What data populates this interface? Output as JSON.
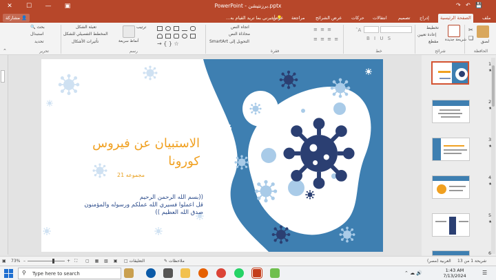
{
  "window": {
    "title": "PowerPoint - برزنتيشن.pptx",
    "signin_prompt": "أخبرني بما تريد القيام به...",
    "share_label": "مشاركة"
  },
  "tabs": [
    {
      "label": "ملف"
    },
    {
      "label": "الصفحة الرئيسية",
      "active": true
    },
    {
      "label": "إدراج"
    },
    {
      "label": "تصميم"
    },
    {
      "label": "انتقالات"
    },
    {
      "label": "حركات"
    },
    {
      "label": "عرض الشرائح"
    },
    {
      "label": "مراجعة"
    },
    {
      "label": "عرض"
    }
  ],
  "ribbon": {
    "clipboard": {
      "paste": "لصق",
      "group": "الحافظة"
    },
    "slides": {
      "new_slide": "شريحة جديدة",
      "layout": "تخطيط",
      "reset": "إعادة تعيين",
      "section": "مقطع",
      "group": "شرائح"
    },
    "font": {
      "group": "خط"
    },
    "paragraph": {
      "text_direction": "اتجاه النص",
      "align_text": "محاذاة النص",
      "smartart": "التحويل إلى SmartArt",
      "group": "فقرة"
    },
    "drawing": {
      "arrange": "ترتيب",
      "quick_styles": "أنماط سريعة",
      "fill": "تعبئة الشكل",
      "outline": "المخطط التفصيلي للشكل",
      "effects": "تأثيرات الأشكال",
      "group": "رسم"
    },
    "editing": {
      "find": "بحث",
      "replace": "استبدال",
      "select": "تحديد",
      "group": "تحرير"
    }
  },
  "slide": {
    "title_line1": "الاستبيان عن فيروس",
    "title_line2": "كورونا",
    "group_label": "مجموعه 21",
    "basmala": "((بسم الله الرحمن الرحيم",
    "verse": "قل اعملوا فسيري الله عملكم ورسوله والمؤمنون",
    "closing": "صدق الله العظيم ))"
  },
  "thumbnails": [
    {
      "num": "1"
    },
    {
      "num": "2"
    },
    {
      "num": "3"
    },
    {
      "num": "4"
    },
    {
      "num": "5"
    },
    {
      "num": "6"
    }
  ],
  "status": {
    "slide_counter": "شريحة 1 من 13",
    "language": "العربية (مصر)",
    "notes": "ملاحظات",
    "comments": "التعليقات",
    "zoom": "73%"
  },
  "taskbar": {
    "search_placeholder": "Type here to search",
    "time": "1:43 AM",
    "date": "7/13/2024"
  },
  "colors": {
    "ppt_accent": "#b7472a",
    "slide_blue": "#3e7fb1",
    "virus_navy": "#2b3f72",
    "title_orange": "#f0a020"
  }
}
